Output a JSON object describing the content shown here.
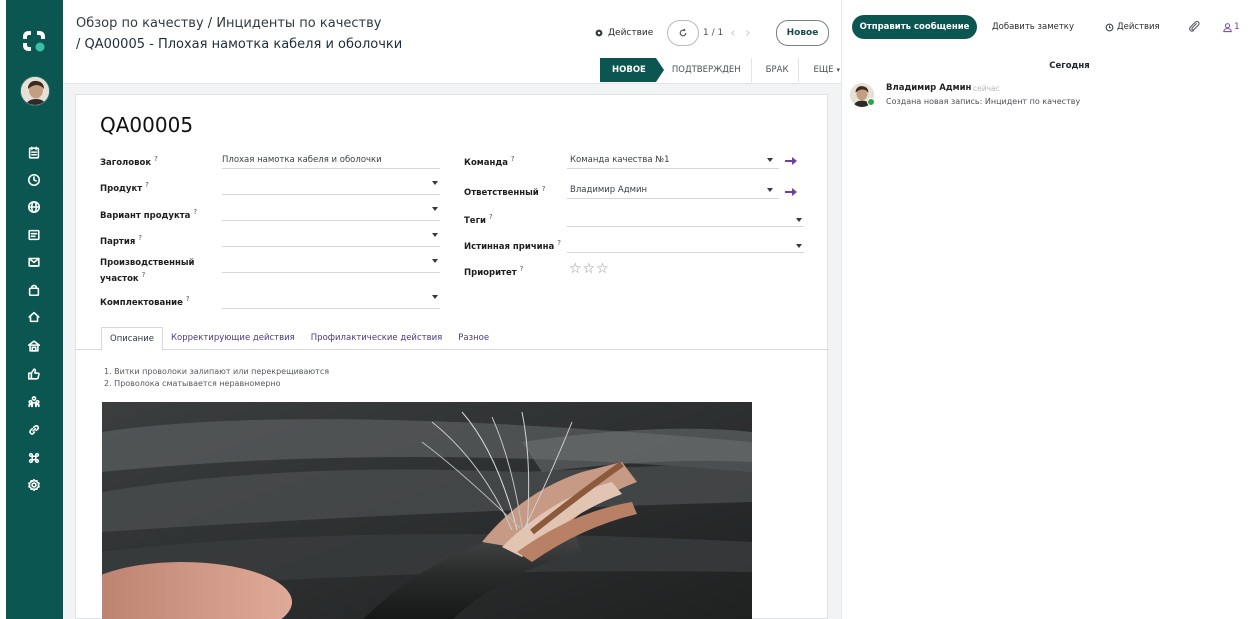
{
  "breadcrumb": {
    "crumb1": "Обзор по качеству",
    "sep": " / ",
    "crumb2": "Инциденты по качеству",
    "current": "/ QA00005 - Плохая намотка кабеля и оболочки"
  },
  "toolbar": {
    "action_label": "Действие",
    "pager": "1 / 1",
    "new_label": "Новое"
  },
  "status": {
    "stages": [
      "НОВОЕ",
      "ПОДТВЕРЖДЕН",
      "БРАК"
    ],
    "active_index": 0,
    "more_label": "ЕЩЕ"
  },
  "record": {
    "title": "QA00005",
    "fields_left": [
      {
        "label": "Заголовок",
        "help": "?",
        "value": "Плохая намотка кабеля и оболочки"
      },
      {
        "label": "Продукт",
        "help": "?",
        "value": ""
      },
      {
        "label": "Вариант продукта",
        "help": "?",
        "value": ""
      },
      {
        "label": "Партия",
        "help": "?",
        "value": ""
      },
      {
        "label": "Производственный",
        "label2": "участок",
        "help": "?",
        "value": ""
      },
      {
        "label": "Комплектование",
        "help": "?",
        "value": ""
      }
    ],
    "fields_right": [
      {
        "label": "Команда",
        "help": "?",
        "value": "Команда качества №1"
      },
      {
        "label": "Ответственный",
        "help": "?",
        "value": "Владимир Админ"
      },
      {
        "label": "Теги",
        "help": "?",
        "value": ""
      },
      {
        "label": "Истинная причина",
        "help": "?",
        "value": ""
      },
      {
        "label": "Приоритет",
        "help": "?",
        "stars": "☆☆☆",
        "rating": 0
      }
    ]
  },
  "tabs": [
    "Описание",
    "Корректирующие действия",
    "Профилактические действия",
    "Разное"
  ],
  "description": {
    "line1": "1. Витки проволоки залипают или перекрещиваются",
    "line2": "2. Проволока сматывается неравномерно"
  },
  "chatter": {
    "send_label": "Отправить сообщение",
    "note_label": "Добавить заметку",
    "activities_label": "Действия",
    "followers_count": "1",
    "today_label": "Сегодня",
    "message": {
      "author": "Владимир Админ",
      "time": "сейчас",
      "body": "Создана новая запись: Инцидент по качеству"
    }
  },
  "colors": {
    "brand": "#0c5651",
    "accent": "#6f3f9e",
    "online": "#28a745"
  },
  "icons": {
    "rail": [
      "calendar-icon",
      "clock-icon",
      "globe-icon",
      "inbox-icon",
      "mail-check-icon",
      "bag-icon",
      "home-icon",
      "warehouse-icon",
      "thumbs-up-icon",
      "team-icon",
      "link-icon",
      "command-icon",
      "settings-icon"
    ]
  }
}
